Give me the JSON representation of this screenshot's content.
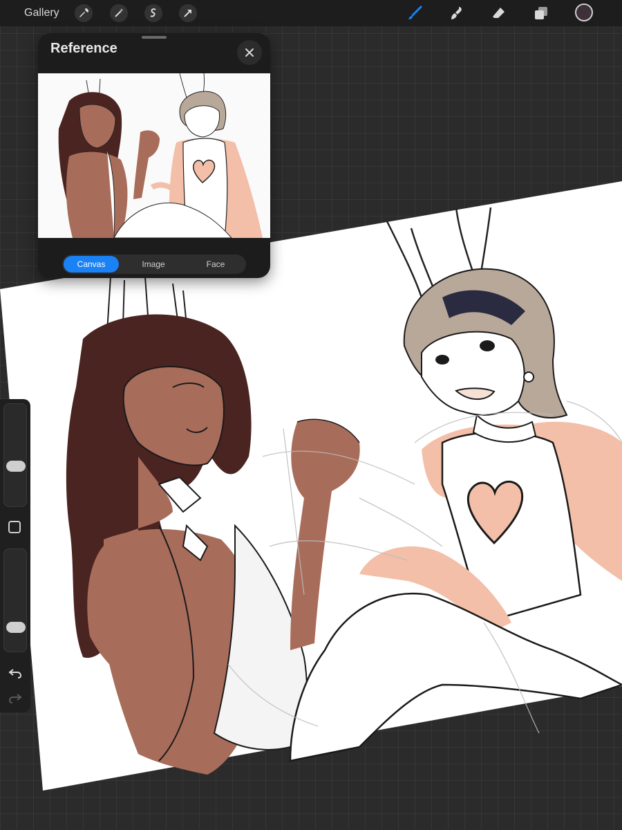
{
  "topbar": {
    "gallery_label": "Gallery",
    "left_tools": [
      "wrench-icon",
      "magic-wand-icon",
      "selection-icon",
      "transform-arrow-icon"
    ],
    "right_tools": [
      "brush-icon",
      "smudge-icon",
      "eraser-icon",
      "layers-icon"
    ],
    "active_tool": "brush-icon",
    "accent_color": "#1a82f5",
    "current_color": "#3d3038"
  },
  "reference": {
    "title": "Reference",
    "tabs": [
      "Canvas",
      "Image",
      "Face"
    ],
    "active_tab": "Canvas"
  },
  "sidebar": {
    "brush_size_level": 0.38,
    "opacity_level": 0.2
  },
  "colors": {
    "canvas_bg": "#ffffff",
    "workspace_bg": "#2b2b2b",
    "hair_dark": "#4a2420",
    "skin_dark": "#a86c5a",
    "skin_light": "#f3bfa8",
    "hair_light": "#b8a89a"
  }
}
